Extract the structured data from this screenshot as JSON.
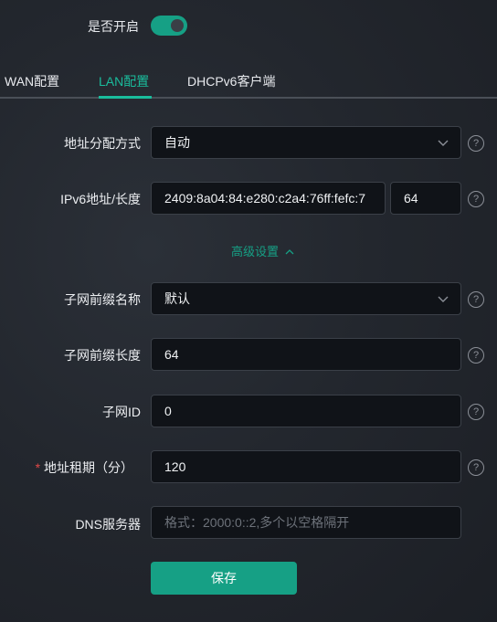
{
  "enable": {
    "label": "是否开启",
    "on": true
  },
  "tabs": [
    {
      "label": "WAN配置",
      "active": false
    },
    {
      "label": "LAN配置",
      "active": true
    },
    {
      "label": "DHCPv6客户端",
      "active": false
    }
  ],
  "form": {
    "assign_mode": {
      "label": "地址分配方式",
      "value": "自动"
    },
    "ipv6": {
      "label": "IPv6地址/长度",
      "address": "2409:8a04:84:e280:c2a4:76ff:fefc:7",
      "prefix_length": "64"
    },
    "advanced_toggle": "高级设置",
    "subnet_prefix_name": {
      "label": "子网前缀名称",
      "value": "默认"
    },
    "subnet_prefix_length": {
      "label": "子网前缀长度",
      "value": "64"
    },
    "subnet_id": {
      "label": "子网ID",
      "value": "0"
    },
    "lease": {
      "required_mark": "*",
      "label": "地址租期（分）",
      "value": "120"
    },
    "dns": {
      "label": "DNS服务器",
      "value": "",
      "placeholder": "格式：2000:0::2,多个以空格隔开"
    },
    "save_label": "保存"
  },
  "help_symbol": "?",
  "colors": {
    "accent": "#16a085",
    "required": "#e04848",
    "field_bg": "#101318"
  },
  "icons": [
    "chevron-down-icon",
    "chevron-up-icon",
    "help-circle-icon"
  ]
}
